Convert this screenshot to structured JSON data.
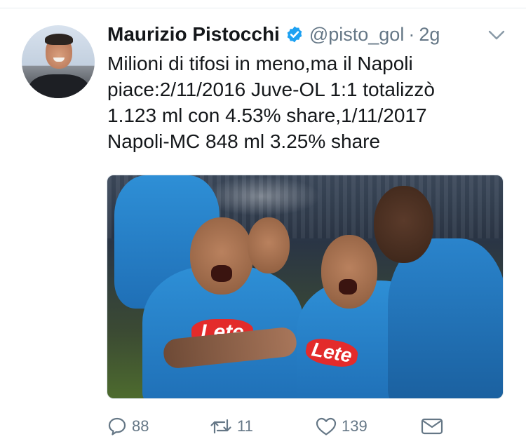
{
  "tweet": {
    "author_name": "Maurizio Pistocchi",
    "handle": "@pisto_gol",
    "separator": "·",
    "time": "2g",
    "text": "Milioni di tifosi in meno,ma il Napoli\npiace:2/11/2016 Juve-OL 1:1 totalizzò\n1.123 ml con 4.53% share,1/11/2017\nNapoli-MC 848 ml 3.25% share",
    "verified_icon": "verified-badge-icon",
    "verified_color": "#1da1f2",
    "menu_icon": "chevron-down-icon"
  },
  "media": {
    "jersey_sponsor": "Lete"
  },
  "actions": {
    "reply": {
      "icon": "reply-icon",
      "count": "88"
    },
    "retweet": {
      "icon": "retweet-icon",
      "count": "11"
    },
    "like": {
      "icon": "heart-icon",
      "count": "139"
    },
    "message": {
      "icon": "envelope-icon"
    }
  },
  "colors": {
    "text": "#14171a",
    "secondary_text": "#657786",
    "divider": "#e6ecf0"
  }
}
